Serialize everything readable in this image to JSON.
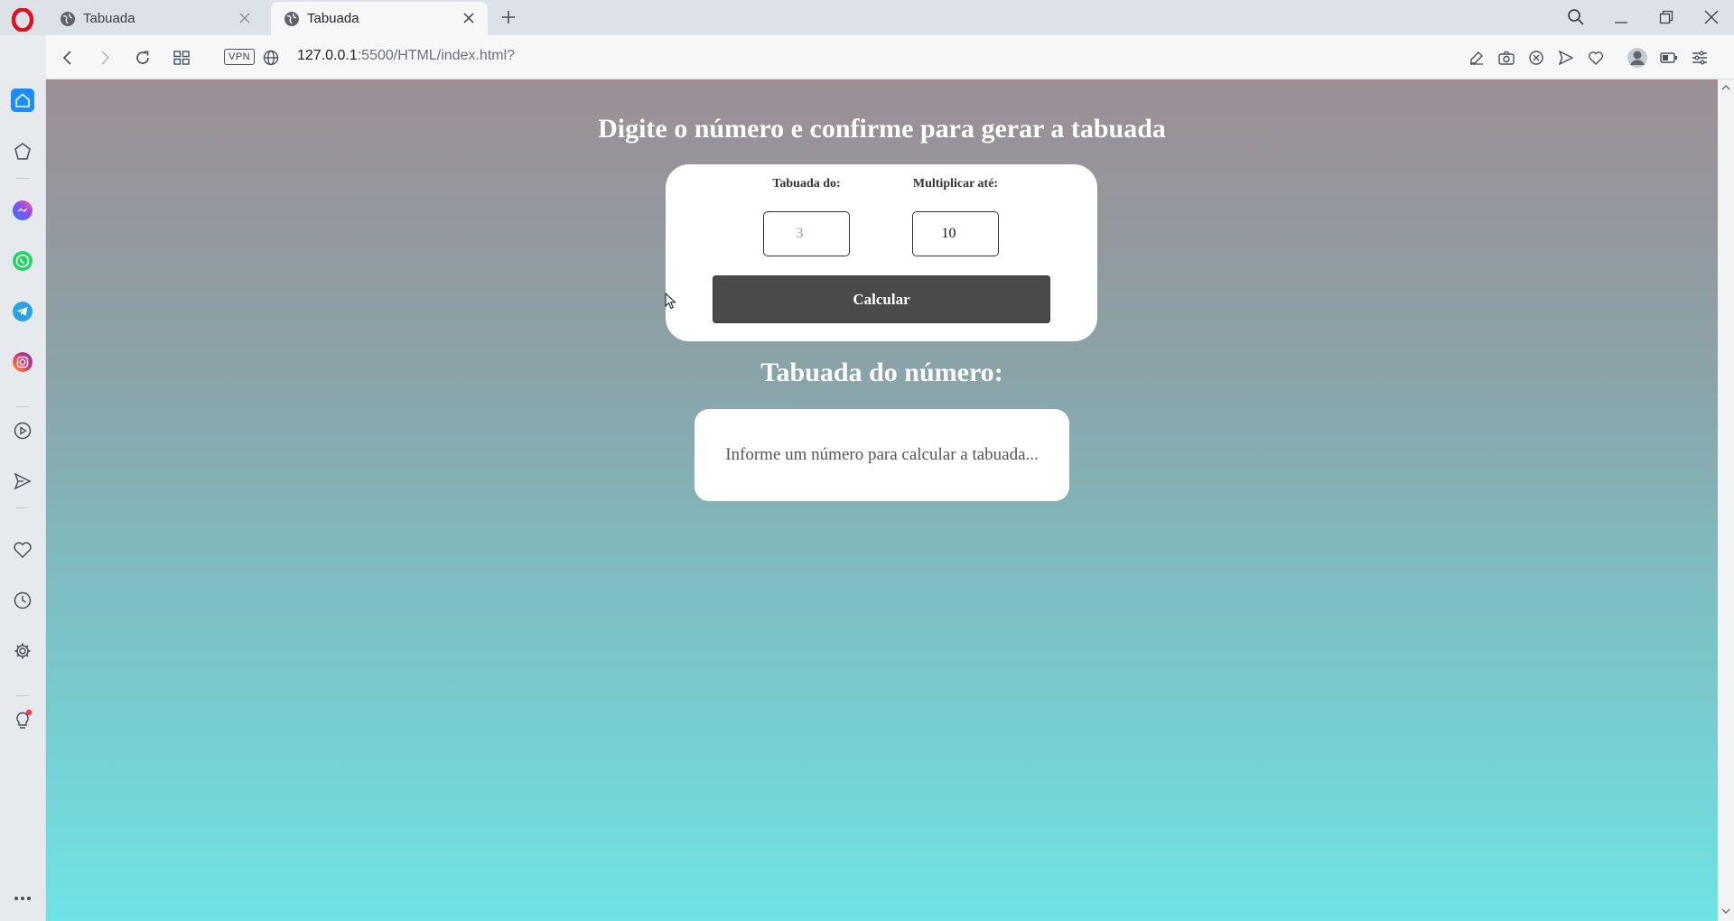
{
  "browser": {
    "tabs": [
      {
        "title": "Tabuada",
        "active": false
      },
      {
        "title": "Tabuada",
        "active": true
      }
    ],
    "address": {
      "host": "127.0.0.1",
      "path": ":5500/HTML/index.html?"
    },
    "vpn_label": "VPN"
  },
  "page": {
    "headline": "Digite o número e confirme para gerar a tabuada",
    "form": {
      "table_label": "Tabuada do:",
      "table_placeholder": "3",
      "multiply_label": "Multiplicar até:",
      "multiply_value": "10",
      "button_label": "Calcular"
    },
    "result": {
      "title": "Tabuada do número:",
      "message": "Informe um número para calcular a tabuada..."
    },
    "colors": {
      "gradient_top": "#9c8f96",
      "gradient_bottom": "#6fe3e6",
      "button": "#4a4a4a",
      "card": "#ffffff"
    }
  },
  "icons": {
    "sidebar": [
      "home-icon",
      "bookmarks-icon",
      "messenger-icon",
      "whatsapp-icon",
      "telegram-icon",
      "instagram-icon",
      "player-icon",
      "send-icon",
      "heart-icon",
      "history-icon",
      "settings-icon",
      "tips-icon",
      "more-icon"
    ]
  }
}
